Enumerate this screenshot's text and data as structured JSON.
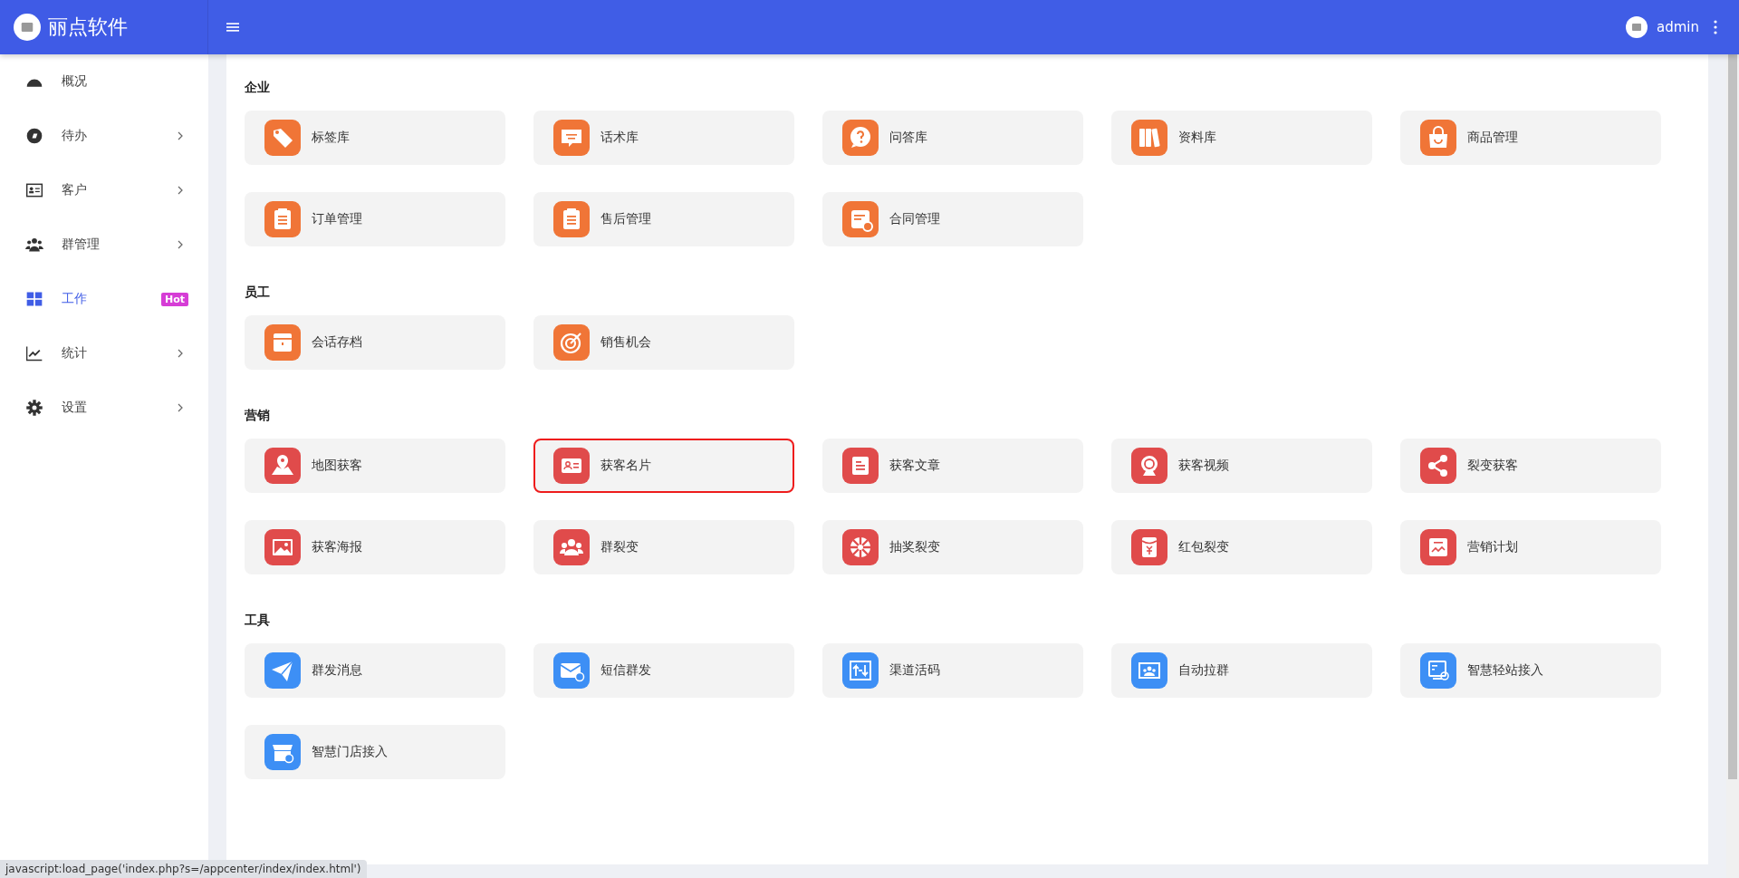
{
  "brand": {
    "name": "丽点软件"
  },
  "header": {
    "user": "admin"
  },
  "sidebar": {
    "items": [
      {
        "label": "概况",
        "kind": "gauge",
        "has_submenu": false,
        "selected": false
      },
      {
        "label": "待办",
        "kind": "compass",
        "has_submenu": true,
        "selected": false
      },
      {
        "label": "客户",
        "kind": "idcard",
        "has_submenu": true,
        "selected": false
      },
      {
        "label": "群管理",
        "kind": "people",
        "has_submenu": true,
        "selected": false
      },
      {
        "label": "工作",
        "kind": "grid",
        "has_submenu": false,
        "selected": true,
        "badge": "Hot"
      },
      {
        "label": "统计",
        "kind": "chart",
        "has_submenu": true,
        "selected": false
      },
      {
        "label": "设置",
        "kind": "gear",
        "has_submenu": true,
        "selected": false
      }
    ]
  },
  "sections": [
    {
      "title": "企业",
      "color": "#f07537",
      "items": [
        {
          "label": "标签库",
          "kind": "tag",
          "highlighted": false
        },
        {
          "label": "话术库",
          "kind": "chat",
          "highlighted": false
        },
        {
          "label": "问答库",
          "kind": "question",
          "highlighted": false
        },
        {
          "label": "资料库",
          "kind": "books",
          "highlighted": false
        },
        {
          "label": "商品管理",
          "kind": "bag",
          "highlighted": false
        },
        {
          "label": "订单管理",
          "kind": "clipboard",
          "highlighted": false
        },
        {
          "label": "售后管理",
          "kind": "clipboard",
          "highlighted": false
        },
        {
          "label": "合同管理",
          "kind": "docstar",
          "highlighted": false
        }
      ]
    },
    {
      "title": "员工",
      "color": "#f07537",
      "items": [
        {
          "label": "会话存档",
          "kind": "box",
          "highlighted": false
        },
        {
          "label": "销售机会",
          "kind": "target",
          "highlighted": false
        }
      ]
    },
    {
      "title": "营销",
      "color": "#e04b4b",
      "items": [
        {
          "label": "地图获客",
          "kind": "map",
          "highlighted": false
        },
        {
          "label": "获客名片",
          "kind": "idcard",
          "highlighted": true
        },
        {
          "label": "获客文章",
          "kind": "doc",
          "highlighted": false
        },
        {
          "label": "获客视频",
          "kind": "webcam",
          "highlighted": false
        },
        {
          "label": "裂变获客",
          "kind": "share",
          "highlighted": false
        },
        {
          "label": "获客海报",
          "kind": "picture",
          "highlighted": false
        },
        {
          "label": "群裂变",
          "kind": "people",
          "highlighted": false
        },
        {
          "label": "抽奖裂变",
          "kind": "wheel",
          "highlighted": false
        },
        {
          "label": "红包裂变",
          "kind": "envelope",
          "highlighted": false
        },
        {
          "label": "营销计划",
          "kind": "trend",
          "highlighted": false
        }
      ]
    },
    {
      "title": "工具",
      "color": "#3d8ff5",
      "items": [
        {
          "label": "群发消息",
          "kind": "send",
          "highlighted": false
        },
        {
          "label": "短信群发",
          "kind": "mail",
          "highlighted": false
        },
        {
          "label": "渠道活码",
          "kind": "arrows",
          "highlighted": false
        },
        {
          "label": "自动拉群",
          "kind": "screen",
          "highlighted": false
        },
        {
          "label": "智慧轻站接入",
          "kind": "monitor",
          "highlighted": false
        },
        {
          "label": "智慧门店接入",
          "kind": "store",
          "highlighted": false
        }
      ]
    }
  ],
  "status_bar": {
    "text": "javascript:load_page('index.php?s=/appcenter/index/index.html')"
  }
}
